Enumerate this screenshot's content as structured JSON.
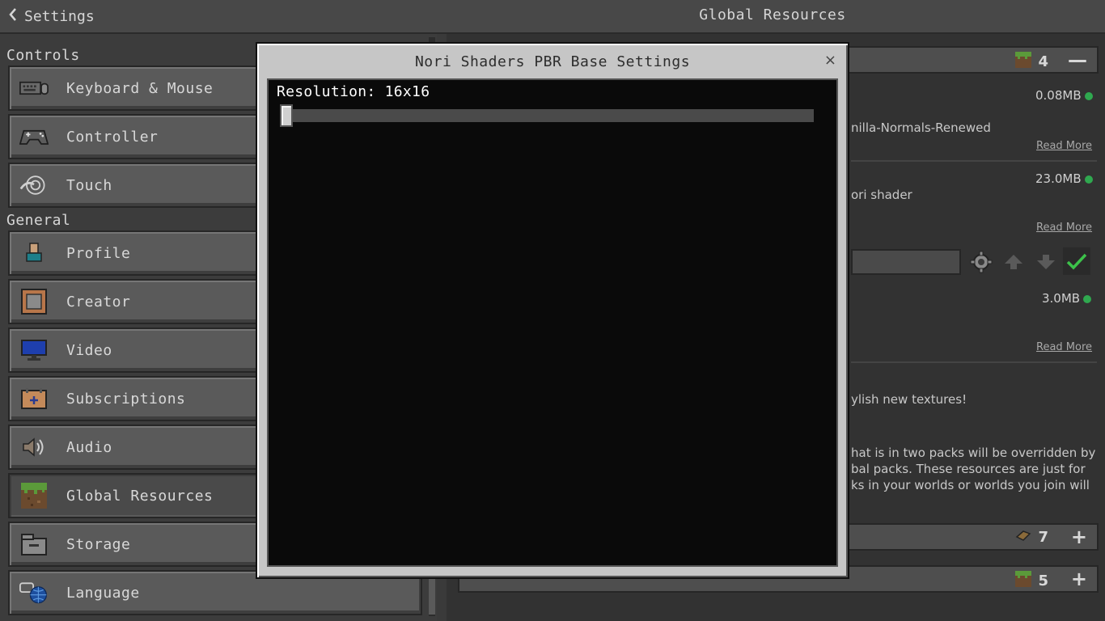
{
  "topbar": {
    "back_label": "Settings",
    "title": "Global Resources"
  },
  "sidebar": {
    "sections": {
      "controls": "Controls",
      "general": "General"
    },
    "items": [
      {
        "label": "Keyboard & Mouse",
        "icon": "keyboard-icon"
      },
      {
        "label": "Controller",
        "icon": "controller-icon"
      },
      {
        "label": "Touch",
        "icon": "touch-icon"
      },
      {
        "label": "Profile",
        "icon": "profile-icon"
      },
      {
        "label": "Creator",
        "icon": "creator-icon"
      },
      {
        "label": "Video",
        "icon": "video-icon"
      },
      {
        "label": "Subscriptions",
        "icon": "subscriptions-icon"
      },
      {
        "label": "Audio",
        "icon": "audio-icon"
      },
      {
        "label": "Global Resources",
        "icon": "grass-block-icon",
        "active": true
      },
      {
        "label": "Storage",
        "icon": "storage-icon"
      },
      {
        "label": "Language",
        "icon": "language-icon"
      }
    ]
  },
  "resources": {
    "active_header": {
      "count": "4",
      "button": "—"
    },
    "packs": [
      {
        "size": "0.08MB",
        "desc": "nilla-Normals-Renewed",
        "read_more": "Read More"
      },
      {
        "size": "23.0MB",
        "desc": "ori shader",
        "read_more": "Read More"
      },
      {
        "size": "3.0MB",
        "desc": "",
        "read_more": "Read More"
      }
    ],
    "info_lines": [
      "ylish new textures!",
      "hat is in two packs will be overridden by",
      "bal packs. These resources are just for",
      "ks in your worlds or worlds you join will"
    ],
    "available_header": {
      "count": "7",
      "button": "+"
    },
    "get_more_header": {
      "count": "5",
      "button": "+"
    }
  },
  "modal": {
    "title": "Nori Shaders PBR Base Settings",
    "close": "×",
    "slider": {
      "label": "Resolution: 16x16",
      "value": 0
    }
  }
}
